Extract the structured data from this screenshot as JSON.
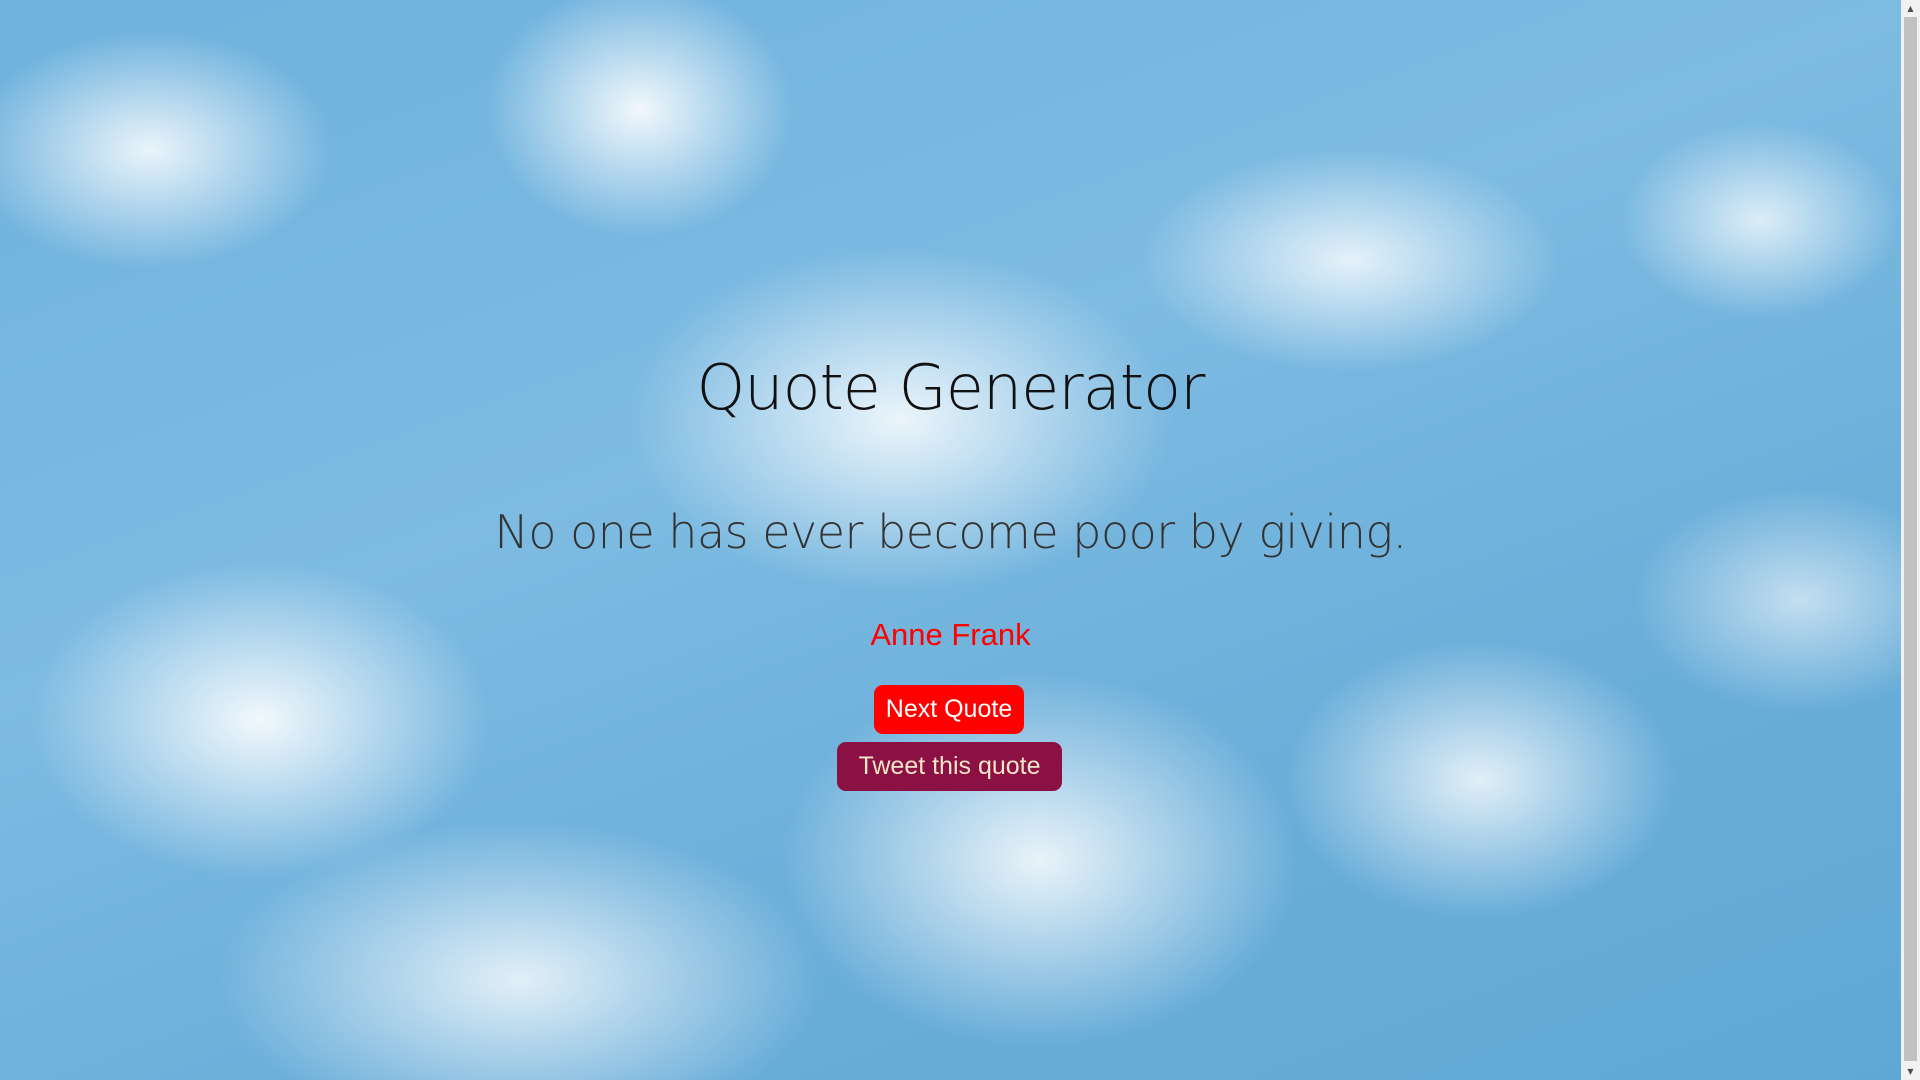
{
  "page": {
    "title": "Quote Generator"
  },
  "quote": {
    "text": "No one has ever become poor by giving.",
    "author": "Anne Frank"
  },
  "buttons": {
    "next_label": "Next Quote",
    "tweet_label": "Tweet this quote"
  },
  "colors": {
    "author": "#ff0000",
    "next_button": "#ff0000",
    "tweet_button": "#8b1044",
    "sky": "#6fb2dd"
  },
  "icons": {
    "scroll_up": "up-arrow-icon",
    "scroll_down": "down-arrow-icon"
  }
}
